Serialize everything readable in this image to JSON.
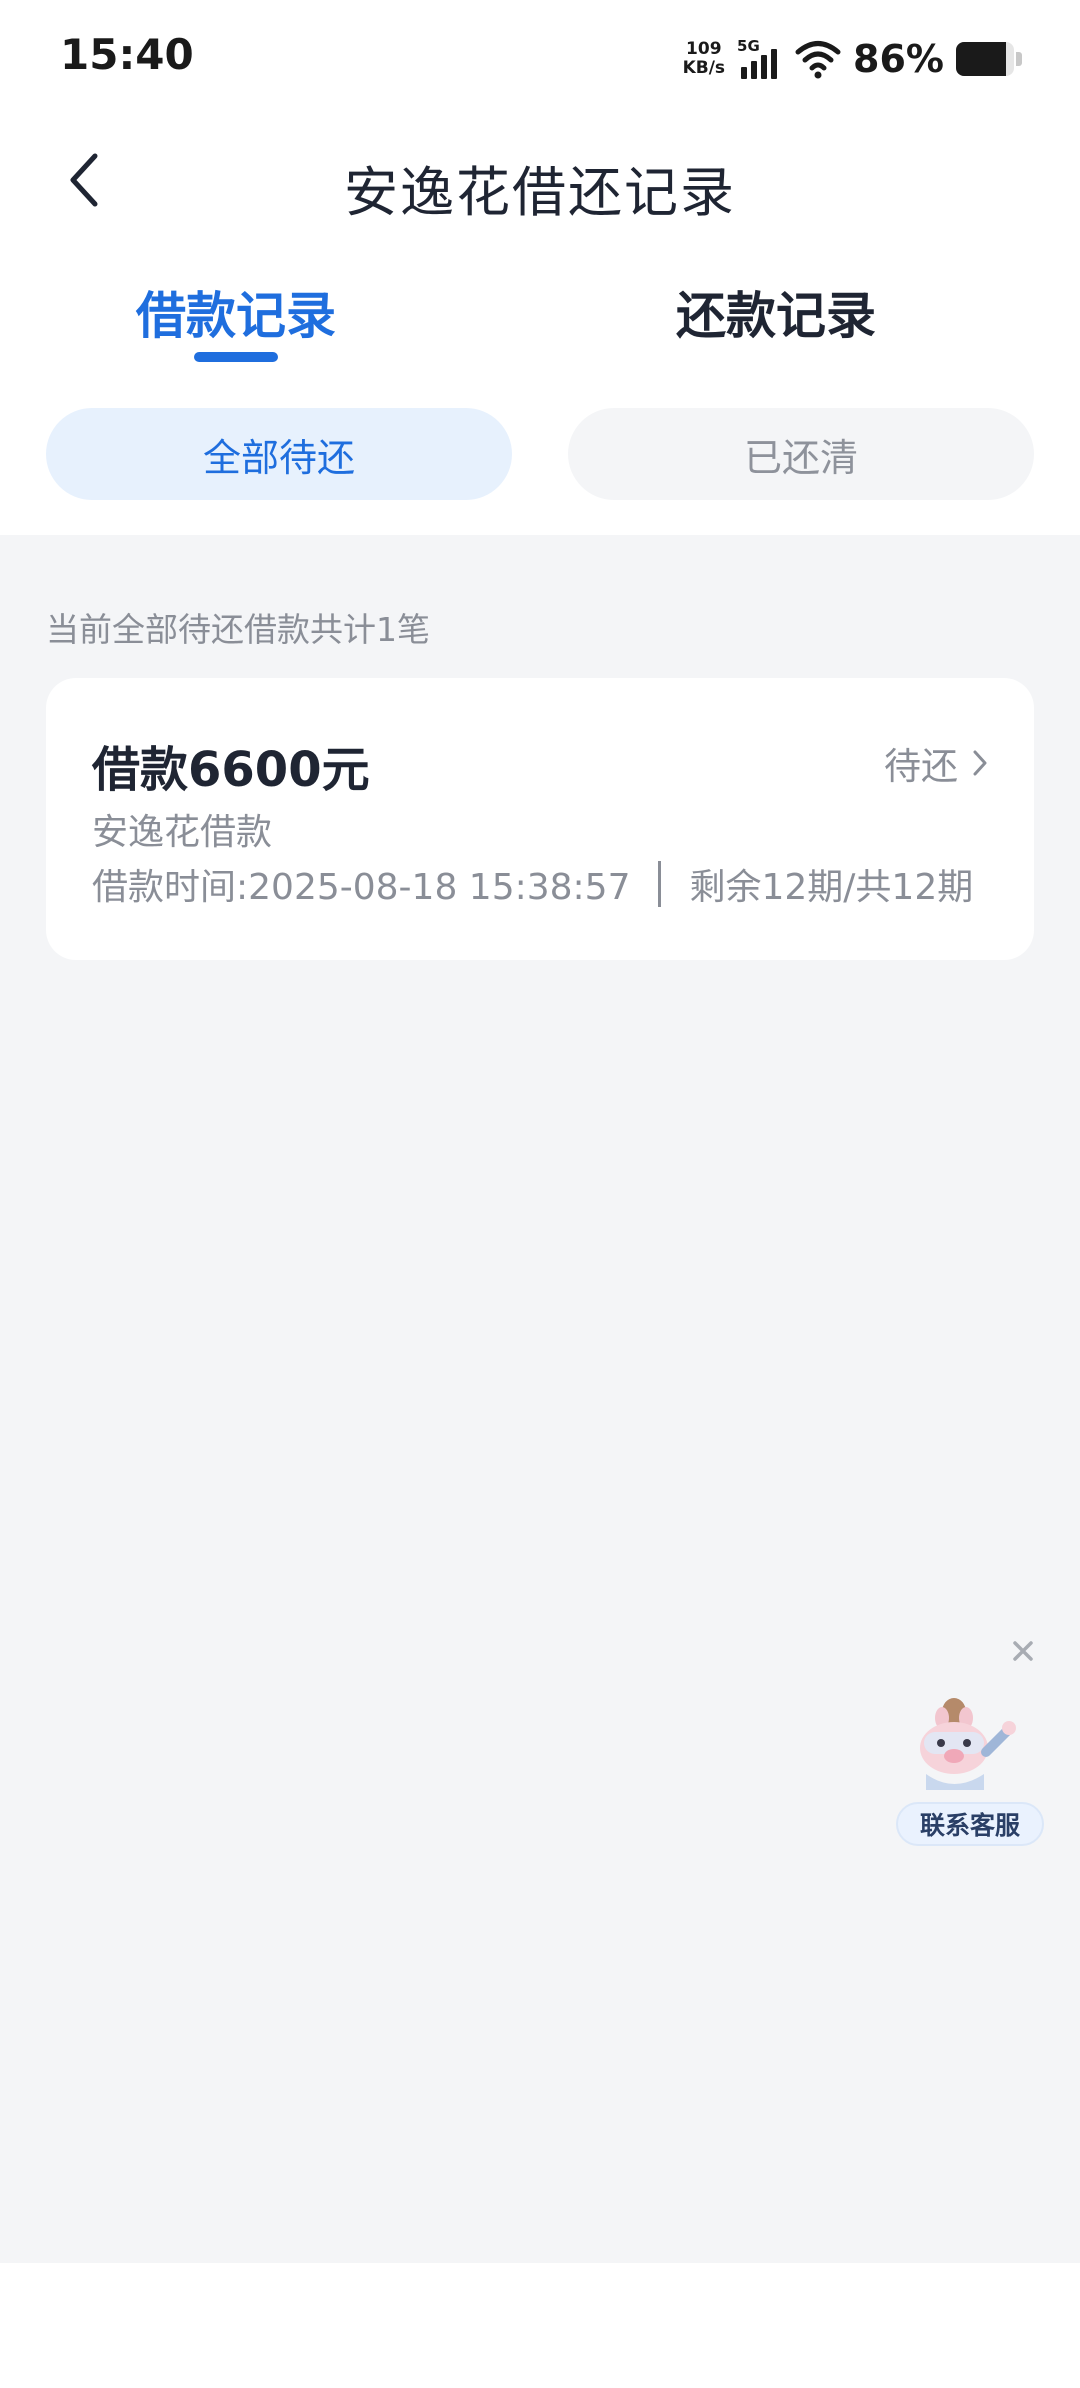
{
  "status_bar": {
    "time": "15:40",
    "net_speed_value": "109",
    "net_speed_unit": "KB/s",
    "signal_label": "5G",
    "battery_percent": "86%",
    "battery_level": 0.86
  },
  "header": {
    "title": "安逸花借还记录"
  },
  "tabs": [
    {
      "label": "借款记录",
      "active": true
    },
    {
      "label": "还款记录",
      "active": false
    }
  ],
  "filters": [
    {
      "label": "全部待还",
      "active": true
    },
    {
      "label": "已还清",
      "active": false
    }
  ],
  "summary_text": "当前全部待还借款共计1笔",
  "loan_card": {
    "amount_label": "借款6600元",
    "status": "待还",
    "product": "安逸花借款",
    "time_label": "借款时间:2025-08-18 15:38:57",
    "installments": "剩余12期/共12期"
  },
  "floating_service": {
    "label": "联系客服"
  },
  "colors": {
    "accent": "#1f6ede",
    "background": "#f4f5f7",
    "text_primary": "#1f2533",
    "text_secondary": "#8a8e97"
  }
}
